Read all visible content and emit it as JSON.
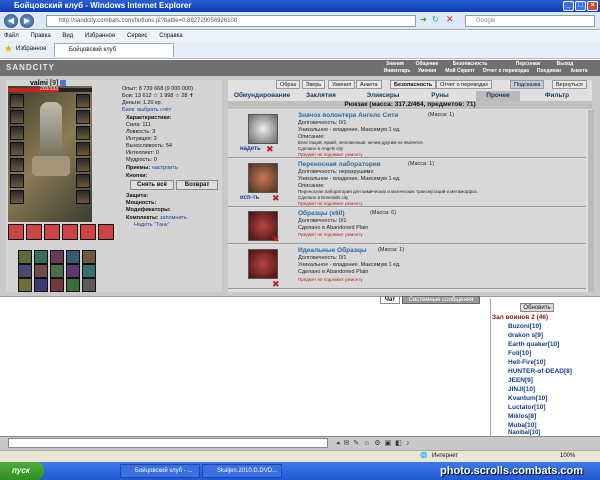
{
  "window": {
    "title": "Бойцовский клуб - Windows Internet Explorer",
    "min": "_",
    "max": "□",
    "close": "×"
  },
  "address": {
    "url": "http://sandcity.combats.com/buttons.pl?battle=0.882729056926108",
    "search_placeholder": "Google"
  },
  "menu": [
    "Файл",
    "Правка",
    "Вид",
    "Избранное",
    "Сервис",
    "Справка"
  ],
  "favorites": {
    "label": "Избранное",
    "tab_title": "Бойцовский клуб"
  },
  "game": {
    "logo": "SANDCITY",
    "topnav": [
      "Знания",
      "Общение",
      "Безопасность",
      "Персонаж",
      "Выход"
    ],
    "topnav2": [
      "Инвентарь",
      "Умения",
      "Мой Скрипт",
      "Отчет о переводах",
      "Поединки",
      "Анкета"
    ]
  },
  "character": {
    "name": "valmi",
    "level": "[9]",
    "hp": "203/333",
    "hp_fraction": 0.61,
    "stats": [
      "Опыт: 8 739 668 (9 000 000)",
      "Бои: 13 612 ☆ 1 998 ☆ 28 ✝",
      "Деньги: 1.20 кр.",
      "Банк: выбрать счёт"
    ],
    "attributes": [
      "Характеристики:",
      "Сила: 111",
      "Ловкость: 3",
      "Интуиция: 3",
      "Выносливость: 54",
      "Интеллект: 0",
      "Мудрость: 0"
    ],
    "reception": "Приемы:",
    "reception_link": "настроить",
    "buttons": "Кнопки:",
    "undress": "Снять всё",
    "return": "Возврат",
    "sections": [
      "Защита:",
      "Мощность:",
      "Модификаторы:"
    ],
    "sets": "Комплекты:",
    "sets_link": "запомнить",
    "set_item": "Надеть \"Танк\""
  },
  "rightpanel": {
    "top_buttons": [
      "Образ",
      "Зверь",
      "Умения",
      "Анкета",
      "Безопасность",
      "Отчет о переводах",
      "Подсказка",
      "Вернуться"
    ],
    "categories": [
      "Обмундирование",
      "Заклятия",
      "Эликсиры",
      "Руны",
      "Прочее",
      "Фильтр"
    ],
    "inventory_header": "Рюкзак (масса: 317.2/464, предметов: 71)",
    "items": [
      {
        "name": "Значок волонтера Ангелс Сити",
        "mass": "(Масса: 1)",
        "lines": [
          "Долговечность: 0/1",
          "Уникальное - владение. Максимум 1 ед.",
          "Описание:",
          "Блестящий, яркий, легковесный, ничем другим не является",
          "Сделано в Angels city"
        ],
        "warn": "Предмет не подлежит ремонту",
        "action": "надеть"
      },
      {
        "name": "Переносная лаборатория",
        "mass": "(Масса: 1)",
        "lines": [
          "Долговечность: неразрушимо",
          "Уникальное - владение. Максимум 1 ед.",
          "Описание:",
          "Переносная лаборатория для химических и магических трансмутаций и метаморфоз.",
          "Сделано в Emeralds city"
        ],
        "warn": "Предмет не подлежит ремонту",
        "action": "исп-ть"
      },
      {
        "name": "Образцы (x60)",
        "mass": "(Масса: 6)",
        "lines": [
          "Долговечность: 0/1",
          "Сделано в Abandoned Plain"
        ],
        "warn": "Предмет не подлежит ремонту",
        "action": ""
      },
      {
        "name": "Идеальные Образцы",
        "mass": "(Масса: 1)",
        "lines": [
          "Долговечность: 0/1",
          "Уникальное - владение. Максимум 1 ед.",
          "Сделано в Abandoned Plain"
        ],
        "warn": "Предмет не подлежит ремонту",
        "action": ""
      }
    ]
  },
  "chat": {
    "tabs": [
      "Чат",
      "Системные сообщения"
    ],
    "refresh": "Обновить",
    "room": "Зал воинов 2 (46)",
    "users": [
      "Buzoni[10]",
      "drakon s[9]",
      "Earth quaker[10]",
      "Foli[10]",
      "Hell-Fire[10]",
      "HUNTER-of-DEAD[8]",
      "JEEN[9]",
      "JINJI[10]",
      "Kvantum[10]",
      "Luctator[10]",
      "Miklos[8]",
      "Muba[10]",
      "Naoibal[10]"
    ]
  },
  "status": {
    "zone": "Интернет",
    "zoom": "100%"
  },
  "taskbar": {
    "start": "пуск",
    "items": [
      "Бойцовский клуб - ...",
      "Skaljen.2010.D.DVD..."
    ],
    "watermark": "photo.scrolls.combats.com"
  }
}
